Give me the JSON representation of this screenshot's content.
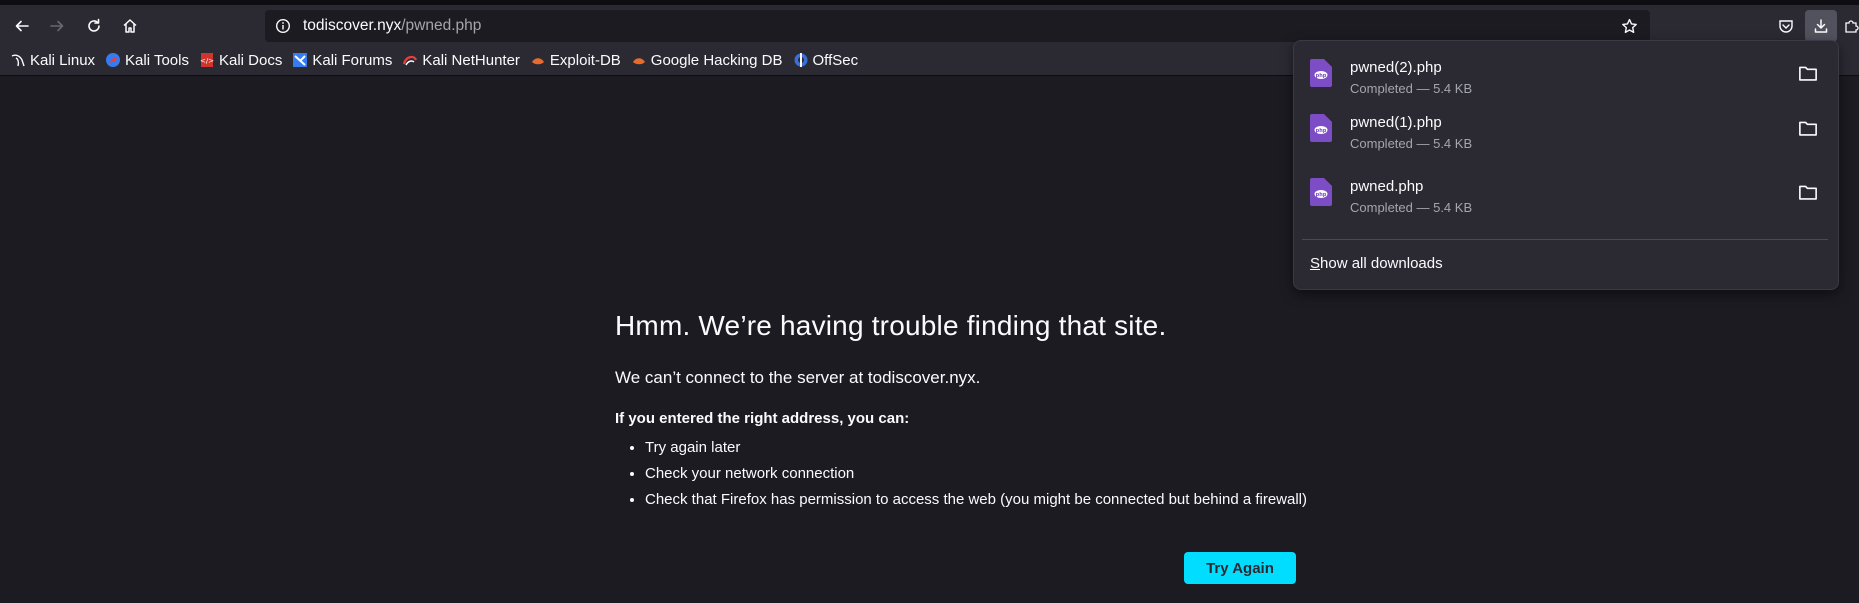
{
  "browser": {
    "url_host": "todiscover.nyx",
    "url_path": "/pwned.php"
  },
  "bookmarks": [
    {
      "label": "Kali Linux",
      "icon": "kali-dragon-icon"
    },
    {
      "label": "Kali Tools",
      "icon": "kali-tools-icon"
    },
    {
      "label": "Kali Docs",
      "icon": "kali-docs-icon"
    },
    {
      "label": "Kali Forums",
      "icon": "kali-forums-icon"
    },
    {
      "label": "Kali NetHunter",
      "icon": "kali-nethunter-icon"
    },
    {
      "label": "Exploit-DB",
      "icon": "exploit-db-icon"
    },
    {
      "label": "Google Hacking DB",
      "icon": "ghdb-icon"
    },
    {
      "label": "OffSec",
      "icon": "offsec-icon"
    }
  ],
  "error_page": {
    "title": "Hmm. We’re having trouble finding that site.",
    "subtitle": "We can’t connect to the server at todiscover.nyx.",
    "bold_text": "If you entered the right address, you can:",
    "items": [
      "Try again later",
      "Check your network connection",
      "Check that Firefox has permission to access the web (you might be connected but behind a firewall)"
    ],
    "button_label": "Try Again"
  },
  "downloads": {
    "items": [
      {
        "name": "pwned(2).php",
        "status": "Completed — 5.4 KB"
      },
      {
        "name": "pwned(1).php",
        "status": "Completed — 5.4 KB"
      },
      {
        "name": "pwned.php",
        "status": "Completed — 5.4 KB"
      }
    ],
    "show_all_prefix": "S",
    "show_all_rest": "how all downloads"
  },
  "colors": {
    "page_bg": "#1c1b22",
    "toolbar_bg": "#2b2a33",
    "accent": "#00ddff",
    "php_icon": "#7c4dc4"
  }
}
